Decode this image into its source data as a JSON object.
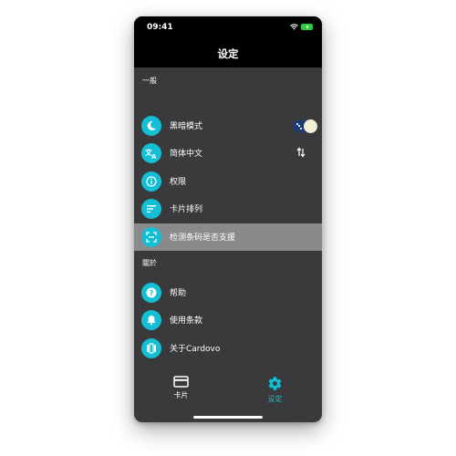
{
  "status_bar": {
    "time": "09:41"
  },
  "header": {
    "title": "设定"
  },
  "sections": {
    "general": {
      "header": "一般",
      "items": [
        {
          "label": "黑暗模式",
          "icon": "moon-icon"
        },
        {
          "label": "简体中文",
          "icon": "translate-icon"
        },
        {
          "label": "权限",
          "icon": "info-icon"
        },
        {
          "label": "卡片排列",
          "icon": "sort-icon"
        },
        {
          "label": "检测条码是否支援",
          "icon": "barcode-scan-icon"
        }
      ]
    },
    "about": {
      "header": "關於",
      "items": [
        {
          "label": "帮助",
          "icon": "help-icon"
        },
        {
          "label": "使用条款",
          "icon": "bell-icon"
        },
        {
          "label": "关于Cardovo",
          "icon": "app-icon"
        }
      ]
    }
  },
  "dark_mode_toggle": {
    "on": true
  },
  "tabs": [
    {
      "label": "卡片",
      "icon": "card-icon",
      "active": false
    },
    {
      "label": "设定",
      "icon": "gear-icon",
      "active": true
    }
  ],
  "colors": {
    "accent": "#13bfd5",
    "background": "#3a393b",
    "header_bg": "#000000",
    "highlight_row": "#8a898c"
  }
}
